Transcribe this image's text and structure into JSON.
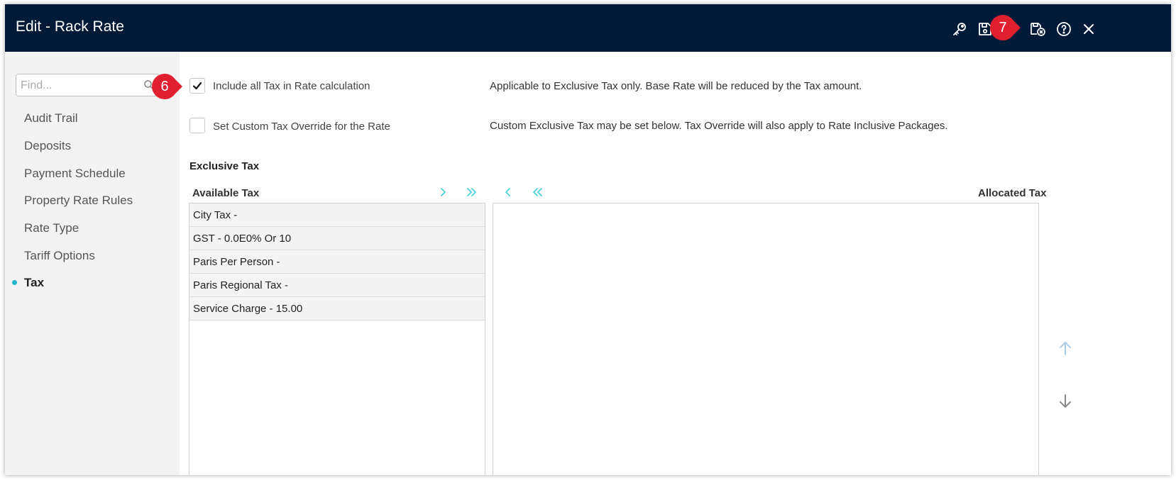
{
  "window": {
    "title": "Edit - Rack Rate"
  },
  "toolbar": {
    "icons": [
      "key-icon",
      "save-icon",
      "save-and-close-icon",
      "help-icon",
      "close-icon"
    ]
  },
  "sidebar": {
    "search_placeholder": "Find...",
    "items": [
      {
        "label": "Audit Trail"
      },
      {
        "label": "Deposits"
      },
      {
        "label": "Payment Schedule"
      },
      {
        "label": "Property Rate Rules"
      },
      {
        "label": "Rate Type"
      },
      {
        "label": "Tariff Options"
      },
      {
        "label": "Tax",
        "active": true
      }
    ]
  },
  "options": {
    "include_all_tax": {
      "label": "Include all Tax in Rate calculation",
      "checked": true,
      "description": "Applicable to Exclusive Tax only. Base Rate will be reduced by the Tax amount."
    },
    "custom_tax_override": {
      "label": "Set Custom Tax Override for the Rate",
      "checked": false,
      "description": "Custom Exclusive Tax may be set below. Tax Override will also apply to Rate Inclusive Packages."
    }
  },
  "exclusive_tax": {
    "title": "Exclusive Tax",
    "available_header": "Available Tax",
    "allocated_header": "Allocated Tax",
    "available": [
      "City Tax -",
      "GST - 0.0E0% Or 10",
      "Paris Per Person -",
      "Paris Regional Tax -",
      "Service Charge - 15.00"
    ],
    "allocated": []
  },
  "callouts": {
    "badge_6": "6",
    "badge_7": "7"
  },
  "colors": {
    "titlebar": "#001a38",
    "accent": "#1fb8c9",
    "callout": "#e0202e"
  }
}
